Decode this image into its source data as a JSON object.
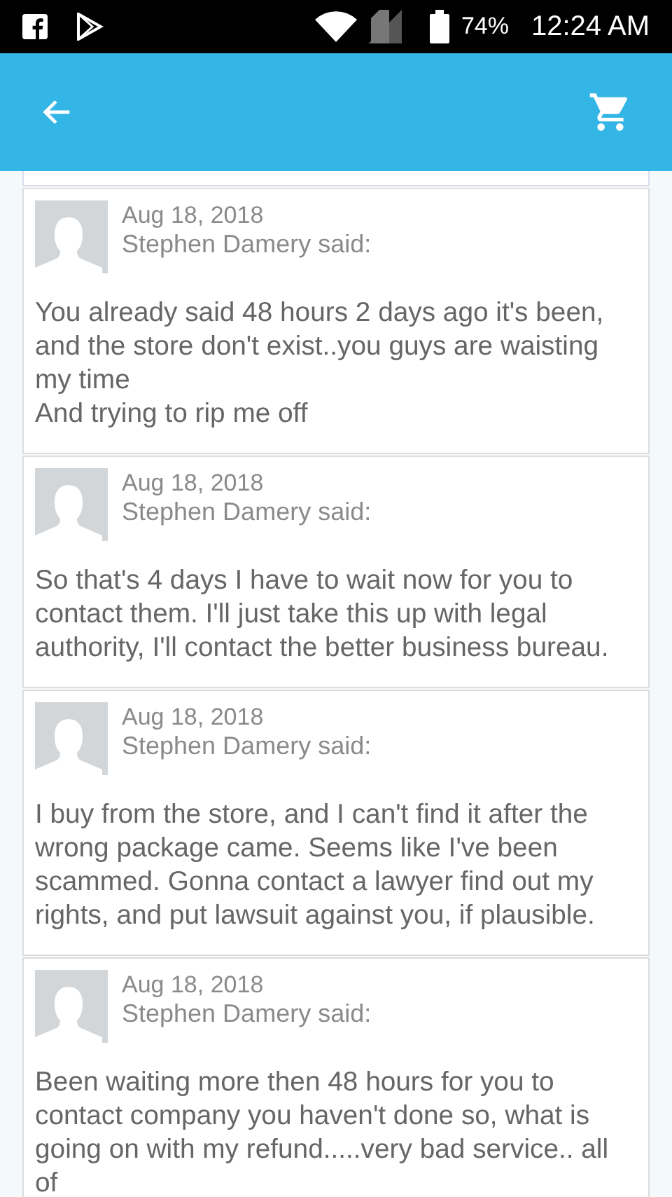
{
  "status_bar": {
    "battery": "74%",
    "time": "12:24 AM"
  },
  "comments": [
    {
      "date": "Aug 18, 2018",
      "author": "Stephen Damery said:",
      "text": "You already said 48 hours 2 days ago it's been, and the store don't exist..you guys are waisting my time\nAnd trying to rip me off"
    },
    {
      "date": "Aug 18, 2018",
      "author": "Stephen Damery said:",
      "text": "So that's 4 days I have to wait now for you to contact them. I'll just take this up with legal authority, I'll contact the better business bureau."
    },
    {
      "date": "Aug 18, 2018",
      "author": "Stephen Damery said:",
      "text": "I buy from the store, and I can't find it after the wrong package came. Seems like I've been scammed. Gonna contact a lawyer find out my rights, and put lawsuit against you, if plausible."
    },
    {
      "date": "Aug 18, 2018",
      "author": "Stephen Damery said:",
      "text": "Been waiting more then 48 hours for you to contact company you haven't done so, what is going on with my refund.....very bad service.. all of"
    }
  ]
}
